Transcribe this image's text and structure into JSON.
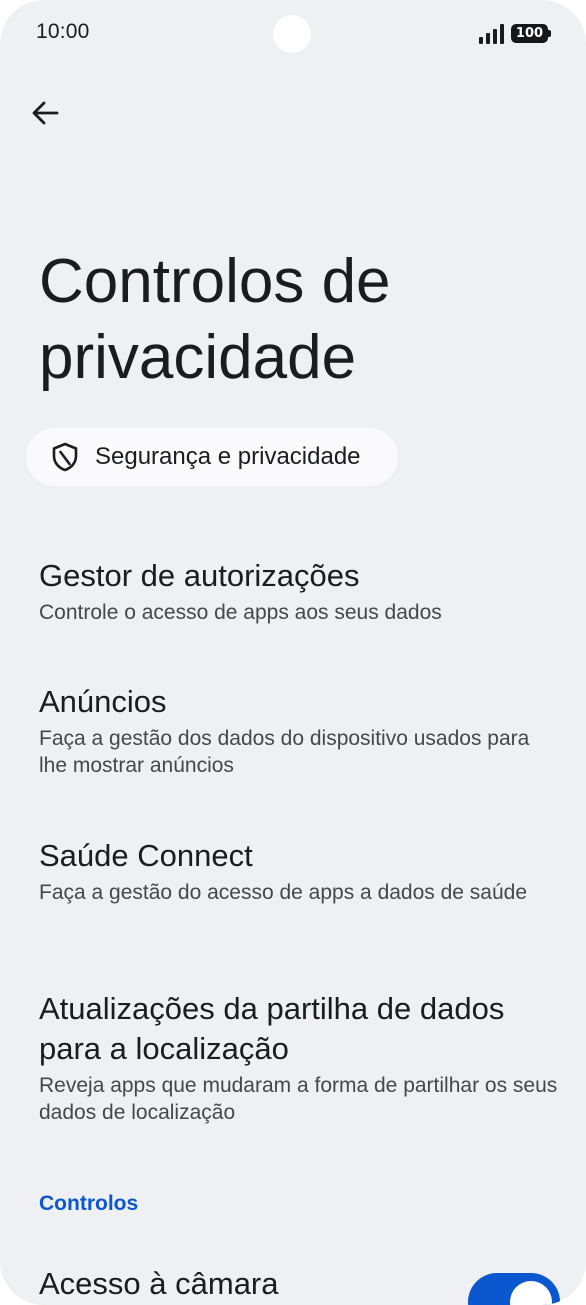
{
  "status_bar": {
    "time": "10:00",
    "battery_level": "100",
    "icons": [
      "signal-icon",
      "battery-icon"
    ]
  },
  "header": {
    "back_icon": "arrow-left-icon",
    "title": "Controlos de privacidade"
  },
  "breadcrumb": {
    "icon": "shield-icon",
    "label": "Segurança e privacidade"
  },
  "items": [
    {
      "title": "Gestor de autorizações",
      "summary": "Controle o acesso de apps aos seus dados"
    },
    {
      "title": "Anúncios",
      "summary": "Faça a gestão dos dados do dispositivo usados para lhe mostrar anúncios"
    },
    {
      "title": "Saúde Connect",
      "summary": "Faça a gestão do acesso de apps a dados de saúde"
    },
    {
      "title": "Atualizações da partilha de dados para a localização",
      "summary": "Reveja apps que mudaram a forma de partilhar os seus dados de localização"
    }
  ],
  "controls_section": {
    "header": "Controlos",
    "camera_access": {
      "title": "Acesso à câmara",
      "enabled": true
    }
  },
  "colors": {
    "background": "#eff0f3",
    "accent": "#0b57d0",
    "text_primary": "#1b1c1f",
    "text_secondary": "#45474c"
  }
}
